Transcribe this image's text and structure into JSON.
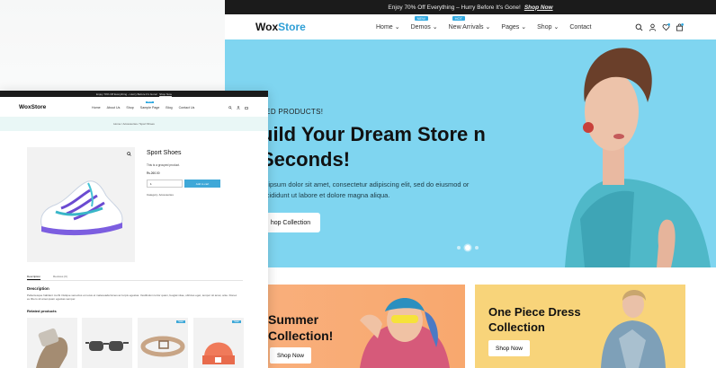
{
  "back_site": {
    "announcement": {
      "text": "Enjoy 70% Off Everything – Hurry Before It's Gone!",
      "link": "Shop Now"
    },
    "logo": {
      "part1": "Wox",
      "part2": "Store"
    },
    "nav": [
      {
        "label": "Home",
        "badge": ""
      },
      {
        "label": "Demos",
        "badge": "NEW"
      },
      {
        "label": "New Arrivals",
        "badge": "HOT"
      },
      {
        "label": "Pages",
        "badge": ""
      },
      {
        "label": "Shop",
        "badge": ""
      },
      {
        "label": "Contact",
        "badge": ""
      }
    ],
    "hero": {
      "eyebrow": "TED PRODUCTS!",
      "title": "uild Your Dream Store n Seconds!",
      "body": "m ipsum dolor sit amet, consectetur adipiscing elit, sed do eiusmod or incididunt ut labore et dolore magna aliqua.",
      "cta": "hop Collection"
    },
    "promo_left": {
      "title": "Summer Collection!",
      "button": "Shop Now"
    },
    "promo_right": {
      "title": "One Piece Dress Collection",
      "button": "Shop Now"
    },
    "colors": {
      "hero_bg": "#7fd5f0",
      "accent": "#2f9fd6",
      "promo_orange": "#f9b07e",
      "promo_yellow": "#f8d47a"
    }
  },
  "front_site": {
    "announcement": {
      "text": "Enjoy 70% Off Everything – Hurry Before It's Gone!",
      "link": "Shop Now"
    },
    "logo": "WoxStore",
    "nav": [
      {
        "label": "Home",
        "badge": ""
      },
      {
        "label": "About Us",
        "badge": ""
      },
      {
        "label": "Shop",
        "badge": ""
      },
      {
        "label": "Sample Page",
        "badge": "NEW"
      },
      {
        "label": "Blog",
        "badge": ""
      },
      {
        "label": "Contact Us",
        "badge": ""
      }
    ],
    "breadcrumb": "Home / Accessories / Sport Shoes",
    "product": {
      "name": "Sport Shoes",
      "short_desc": "This is a grouped product.",
      "price": "Rs.260.00",
      "qty": "1",
      "add_to_cart": "Add to cart",
      "category": "Category: Accessories"
    },
    "tabs": [
      "Description",
      "Reviews (0)"
    ],
    "description_title": "Description",
    "description_text": "Pellentesque habitant morbi tristique senectus et netus et malesuada fames ac turpis egestas. Vestibulum tortor quam, feugiat vitae, ultricies eget, tempor sit amet, ante. Donec eu libero sit amet quam egestas semper.",
    "related_title": "Related products",
    "related_sale_label": "Sale!"
  }
}
